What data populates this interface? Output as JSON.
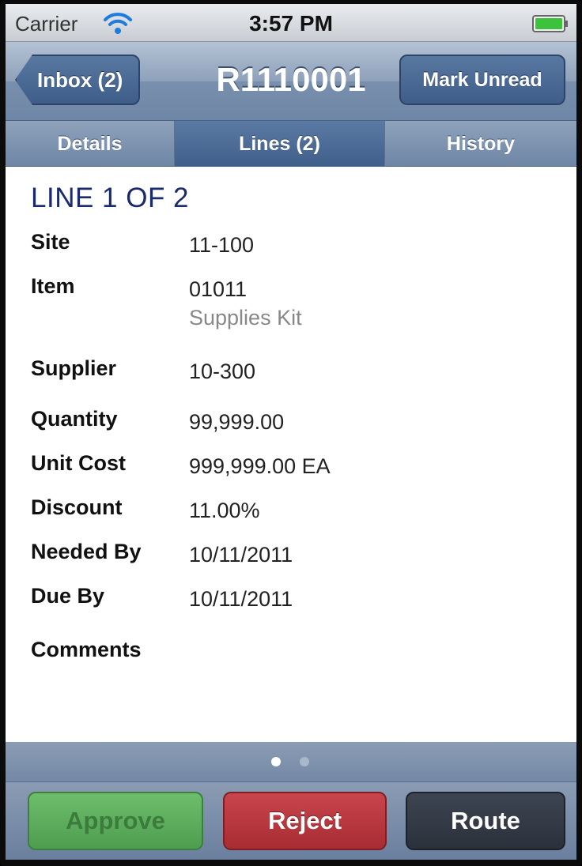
{
  "status_bar": {
    "carrier": "Carrier",
    "time": "3:57 PM",
    "wifi_icon": "wifi-icon",
    "battery_icon": "battery-icon"
  },
  "nav_bar": {
    "back_label": "Inbox (2)",
    "title": "R1110001",
    "action_label": "Mark Unread"
  },
  "tabs": [
    {
      "label": "Details",
      "active": false
    },
    {
      "label": "Lines (2)",
      "active": true
    },
    {
      "label": "History",
      "active": false
    }
  ],
  "content": {
    "heading": "LINE 1 OF 2",
    "fields": {
      "site": {
        "label": "Site",
        "value": "11-100"
      },
      "item": {
        "label": "Item",
        "value": "01011",
        "sub": "Supplies Kit"
      },
      "supplier": {
        "label": "Supplier",
        "value": "10-300"
      },
      "quantity": {
        "label": "Quantity",
        "value": "99,999.00"
      },
      "unit_cost": {
        "label": "Unit Cost",
        "value": "999,999.00 EA"
      },
      "discount": {
        "label": "Discount",
        "value": "11.00%"
      },
      "needed_by": {
        "label": "Needed By",
        "value": "10/11/2011"
      },
      "due_by": {
        "label": "Due By",
        "value": "10/11/2011"
      },
      "comments": {
        "label": "Comments",
        "value": ""
      }
    }
  },
  "page_indicator": {
    "current": 1,
    "total": 2
  },
  "toolbar": {
    "approve_label": "Approve",
    "reject_label": "Reject",
    "route_label": "Route"
  },
  "colors": {
    "approve": "#4f9e50",
    "reject": "#a82c33",
    "route": "#2b313b",
    "heading": "#1a2a6c",
    "nav": "#6f87a6"
  }
}
